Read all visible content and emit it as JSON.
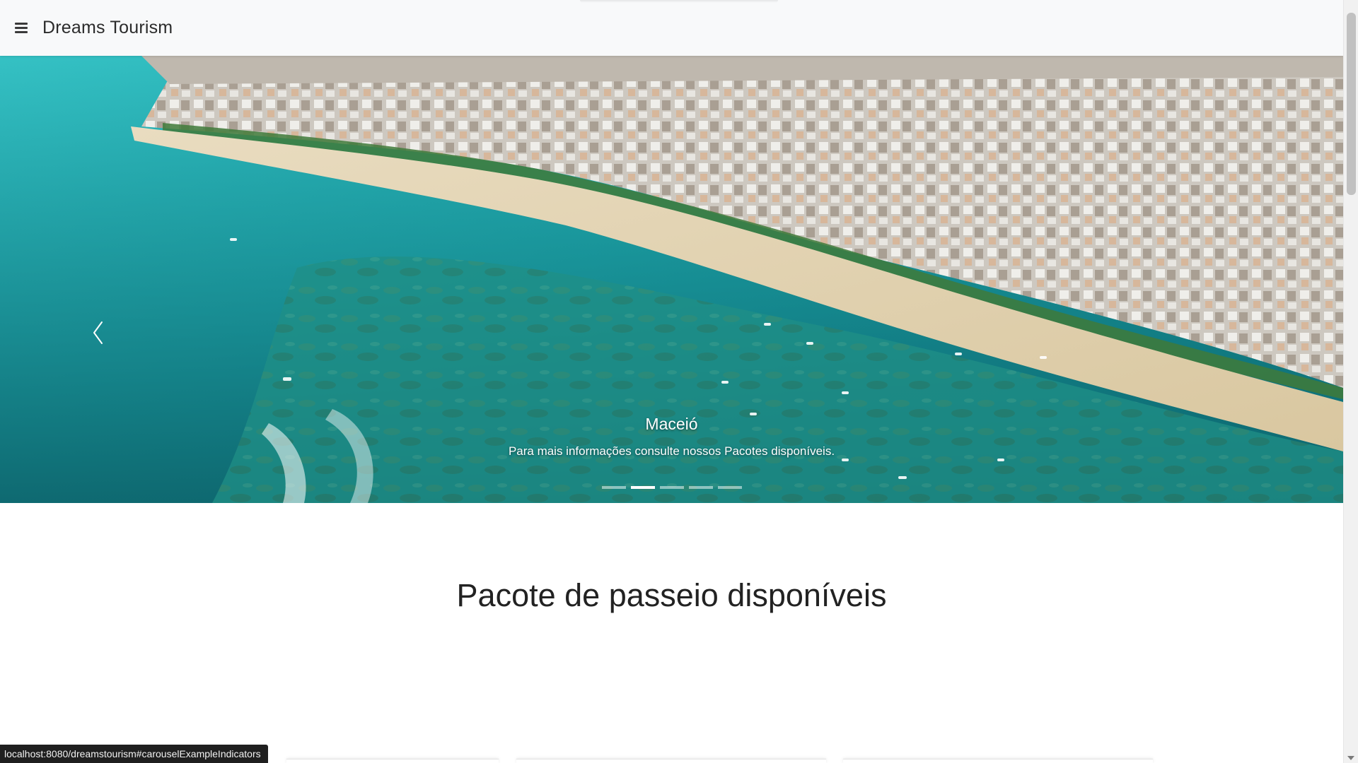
{
  "navbar": {
    "brand": "Dreams Tourism",
    "toggle_icon": "hamburger-menu-icon"
  },
  "carousel": {
    "prev_icon": "chevron-left-icon",
    "slide": {
      "title": "Maceió",
      "text": "Para mais informações consulte nossos Pacotes disponíveis."
    },
    "indicator_count": 5,
    "active_index": 1
  },
  "main": {
    "section_title": "Pacote de passeio disponíveis"
  },
  "status_bar": {
    "url": "localhost:8080/dreamstourism#carouselExampleIndicators"
  }
}
